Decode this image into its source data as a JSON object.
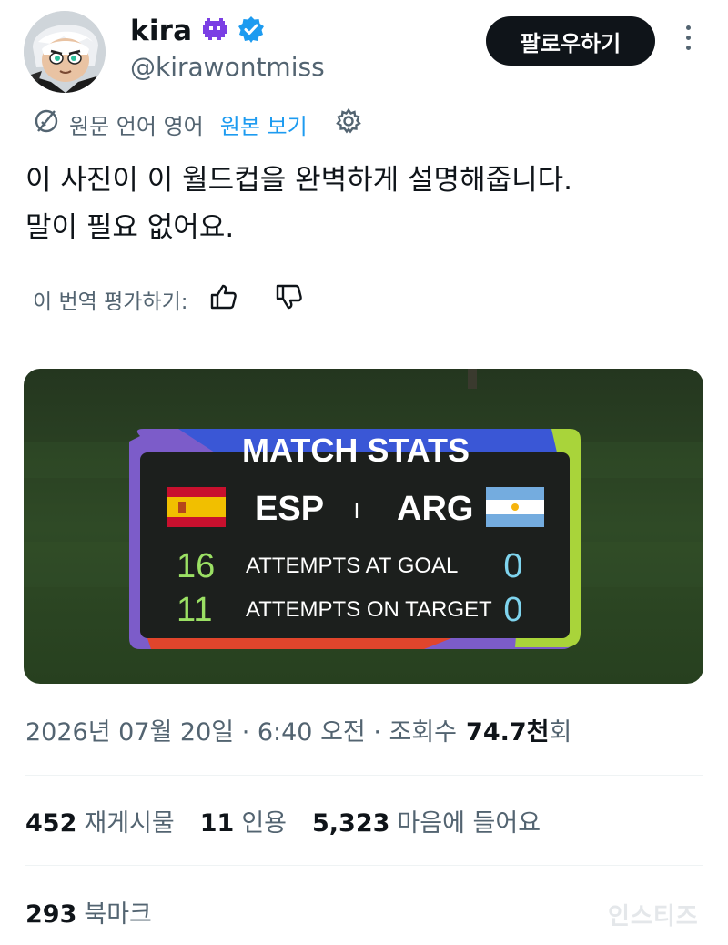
{
  "user": {
    "name": "kira",
    "handle": "@kirawontmiss",
    "follow_label": "팔로우하기"
  },
  "translation": {
    "source_label": "원문 언어 영어",
    "view_original": "원본 보기"
  },
  "tweet": {
    "text": "이 사진이 이 월드컵을 완벽하게 설명해줍니다.\n말이 필요 없어요."
  },
  "rating": {
    "label": "이 번역 평가하기:"
  },
  "media": {
    "panel_title": "MATCH STATS",
    "team_left": "ESP",
    "separator": "I",
    "team_right": "ARG",
    "rows": [
      {
        "left": "16",
        "label": "ATTEMPTS AT GOAL",
        "right": "0"
      },
      {
        "left": "11",
        "label": "ATTEMPTS ON TARGET",
        "right": "0"
      }
    ]
  },
  "meta": {
    "datetime": "2026년 07월 20일 · 6:40 오전 · 조회수",
    "views": "74.7천",
    "views_suffix": "회"
  },
  "stats": {
    "reposts": "452",
    "reposts_label": "재게시물",
    "quotes": "11",
    "quotes_label": "인용",
    "likes": "5,323",
    "likes_label": "마음에 들어요"
  },
  "bookmarks": {
    "count": "293",
    "label": "북마크"
  },
  "watermark": "인스티즈",
  "colors": {
    "link": "#1d9bf0",
    "verified": "#1d9bf0",
    "button_bg": "#0f1419",
    "muted_text": "#536471",
    "alien_emoji": "#7b3fe4"
  },
  "icons": [
    "alien-emoji-icon",
    "verified-badge-icon",
    "more-options-icon",
    "translate-icon",
    "settings-gear-icon",
    "thumbs-up-icon",
    "thumbs-down-icon",
    "spain-flag-icon",
    "argentina-flag-icon"
  ]
}
